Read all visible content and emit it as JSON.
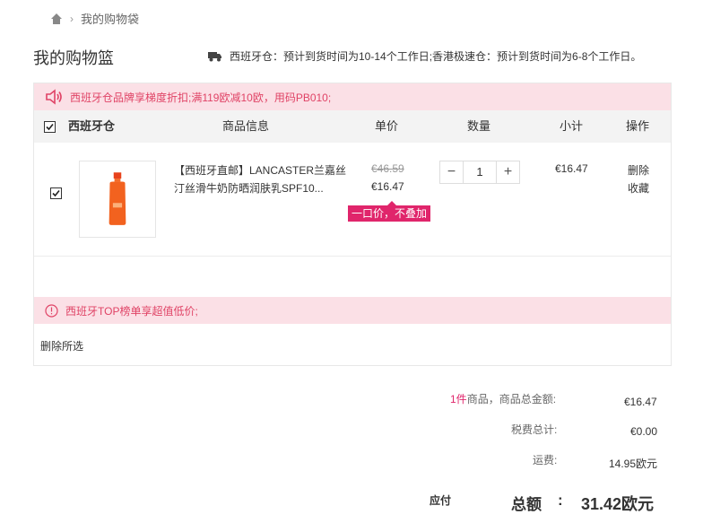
{
  "breadcrumb": {
    "current": "我的购物袋"
  },
  "page": {
    "title": "我的购物篮"
  },
  "shipping": {
    "notice": "西班牙仓：预计到货时间为10-14个工作日;香港极速仓：预计到货时间为6-8个工作日。"
  },
  "promo": {
    "text": "西班牙仓品牌享梯度折扣;满119欧减10欧，用码PB010;"
  },
  "table_header": {
    "warehouse": "西班牙仓",
    "product_info": "商品信息",
    "unit_price": "单价",
    "quantity": "数量",
    "subtotal": "小计",
    "actions": "操作"
  },
  "items": [
    {
      "title": "【西班牙直邮】LANCASTER兰嘉丝汀丝滑牛奶防晒润肤乳SPF10...",
      "old_price": "€46.59",
      "price": "€16.47",
      "price_tag": "一口价，不叠加",
      "quantity": "1",
      "subtotal": "€16.47",
      "delete_label": "删除",
      "favorite_label": "收藏",
      "checked": true
    }
  ],
  "warning": {
    "text": "西班牙TOP榜单享超值低价;"
  },
  "delete_selected": "删除所选",
  "summary": {
    "count": "1件",
    "goods_total_label": "商品，商品总金额:",
    "goods_total": "€16.47",
    "tax_label": "税费总计:",
    "tax": "€0.00",
    "shipping_label": "运费:",
    "shipping": "14.95欧元",
    "pay_label": "应付",
    "total_label": "总额",
    "total_colon": ":",
    "total": "31.42欧元"
  },
  "colors": {
    "accent": "#e0256b",
    "promo_bg": "#fbe0e6",
    "promo_text": "#e04366"
  }
}
